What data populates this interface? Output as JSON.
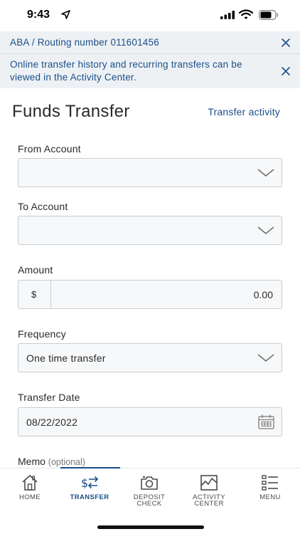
{
  "status_bar": {
    "time": "9:43"
  },
  "banners": {
    "routing": "ABA / Routing number 011601456",
    "history": "Online transfer history and recurring transfers can be viewed in the Activity Center."
  },
  "header": {
    "title": "Funds Transfer",
    "activity_link": "Transfer activity"
  },
  "form": {
    "from_label": "From Account",
    "from_value": "",
    "to_label": "To Account",
    "to_value": "",
    "amount_label": "Amount",
    "currency_symbol": "$",
    "amount_value": "0.00",
    "frequency_label": "Frequency",
    "frequency_value": "One time transfer",
    "date_label": "Transfer Date",
    "date_value": "08/22/2022",
    "memo_label": "Memo",
    "memo_optional": "(optional)"
  },
  "nav": {
    "active": "transfer",
    "home": "HOME",
    "transfer": "TRANSFER",
    "deposit_line1": "DEPOSIT",
    "deposit_line2": "CHECK",
    "activity_line1": "ACTIVITY",
    "activity_line2": "CENTER",
    "menu": "MENU"
  },
  "colors": {
    "accent": "#1a4f8b",
    "banner_bg": "#eef1f4",
    "field_border": "#c8cdd2"
  }
}
